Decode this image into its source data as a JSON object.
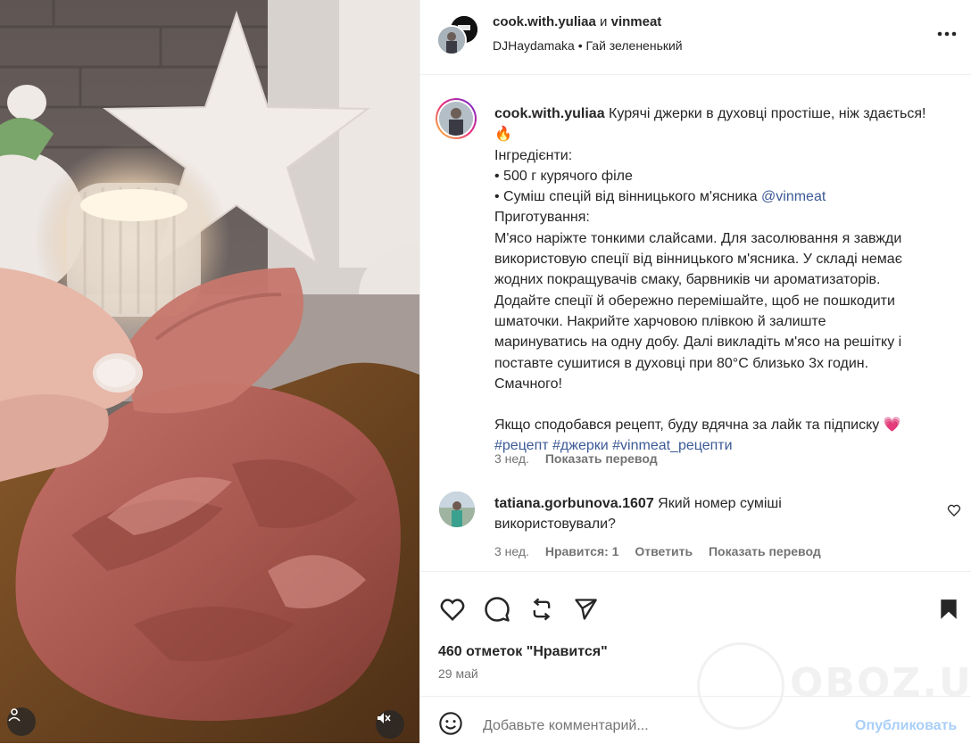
{
  "post": {
    "authors": {
      "primary": "cook.with.yuliaa",
      "conjunction": "и",
      "secondary": "vinmeat"
    },
    "audio": "DJHaydamaka • Гай зелененький"
  },
  "caption": {
    "username": "cook.with.yuliaa",
    "lines": [
      "Курячі джерки в духовці простіше, ніж здається!",
      "🔥",
      "Інгредієнти:",
      "• 500 г курячого філе",
      "• Суміш спецій від вінницького м'ясника ",
      "Приготування:",
      "М'ясо наріжте тонкими слайсами. Для засолювання я завжди",
      "використовую спеції від вінницького м'ясника. У складі немає",
      "жодних покращувачів смаку, барвників чи ароматизаторів.",
      "Додайте спеції й обережно перемішайте, щоб не пошкодити",
      "шматочки. Накрийте харчовою плівкою й залиште",
      "маринуватись на одну добу. Далі викладіть м'ясо на решітку і",
      "поставте сушитися в духовці при 80°C близько 3х годин.",
      "Смачного!",
      "Якщо сподобався рецепт, буду вдячна за лайк та підписку 💗"
    ],
    "mention": "@vinmeat",
    "hashtags": "#рецепт #джерки #vinmeat_рецепти",
    "time": "3 нед.",
    "translate": "Показать перевод"
  },
  "comment": {
    "username": "tatiana.gorbunova.1607",
    "text_line1": "Який номер суміші",
    "text_line2": "використовували?",
    "time": "3 нед.",
    "likes": "Нравится: 1",
    "reply": "Ответить",
    "translate": "Показать перевод"
  },
  "actions": {
    "likes": "460 отметок \"Нравится\"",
    "date": "29 май"
  },
  "add_comment": {
    "placeholder": "Добавьте комментарий...",
    "publish": "Опубликовать"
  },
  "watermark": "OBOZ.UA",
  "icons": {
    "more": "more-dots-icon",
    "like": "heart-icon",
    "comment": "comment-bubble-icon",
    "share": "repost-icon",
    "send": "send-icon",
    "save": "bookmark-icon",
    "emoji": "emoji-icon",
    "user_tag": "user-tag-icon",
    "mute": "speaker-muted-icon"
  }
}
